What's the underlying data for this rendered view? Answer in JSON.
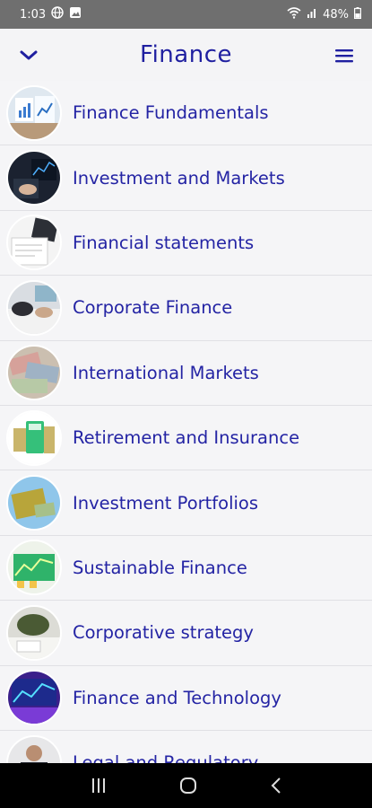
{
  "status": {
    "time": "1:03",
    "battery": "48%"
  },
  "header": {
    "title": "Finance"
  },
  "items": [
    {
      "label": "Finance Fundamentals",
      "icon": "charts-documents-image"
    },
    {
      "label": "Investment and Markets",
      "icon": "trading-screens-image"
    },
    {
      "label": "Financial statements",
      "icon": "calculator-paperwork-image"
    },
    {
      "label": "Corporate Finance",
      "icon": "business-meeting-image"
    },
    {
      "label": "International Markets",
      "icon": "banknotes-image"
    },
    {
      "label": "Retirement and Insurance",
      "icon": "calculator-cash-image"
    },
    {
      "label": "Investment Portfolios",
      "icon": "portfolio-folder-image"
    },
    {
      "label": "Sustainable Finance",
      "icon": "green-chart-image"
    },
    {
      "label": "Corporative strategy",
      "icon": "office-desk-image"
    },
    {
      "label": "Finance and Technology",
      "icon": "tech-screen-image"
    },
    {
      "label": "Legal and Regulatory",
      "icon": "business-person-image"
    }
  ]
}
